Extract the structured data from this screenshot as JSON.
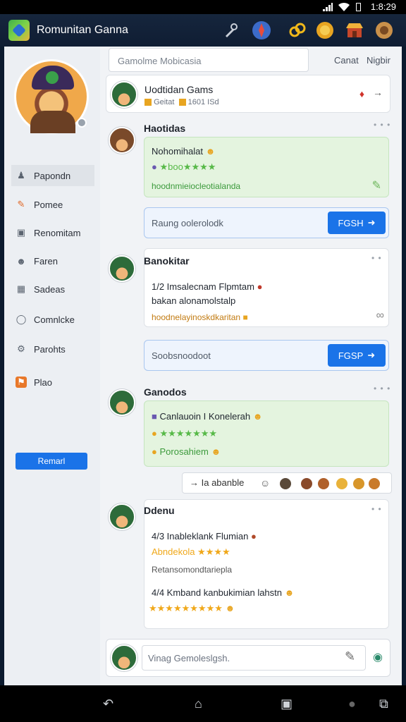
{
  "status_bar": {
    "time": "1:8:29"
  },
  "header": {
    "title": "Romunitan Ganna",
    "icons": [
      "wrench-icon",
      "compass-icon",
      "link-icon",
      "coin-icon",
      "shop-icon",
      "settings-badge-icon"
    ]
  },
  "sidebar": {
    "items": [
      {
        "label": "Papondn",
        "icon": "person-icon"
      },
      {
        "label": "Pomee",
        "icon": "pencil-icon"
      },
      {
        "label": "Renomitam",
        "icon": "window-icon"
      },
      {
        "label": "Faren",
        "icon": "user-icon"
      },
      {
        "label": "Sadeas",
        "icon": "grid-icon"
      },
      {
        "label": "Comnlcke",
        "icon": "chat-icon"
      },
      {
        "label": "Parohts",
        "icon": "gear-icon"
      },
      {
        "label": "Plao",
        "icon": "flag-icon"
      }
    ],
    "button_label": "Remarl"
  },
  "main": {
    "search_placeholder": "Gamolme Mobicasia",
    "links": [
      "Canat",
      "Nigbir"
    ],
    "pinned": {
      "name": "Uodtidan Gams",
      "meta_1": "Geitat",
      "meta_2": "1601",
      "meta_3": "ISd"
    },
    "posts": [
      {
        "name": "Haotidas",
        "dots": "• • •",
        "line_1": "Nohomihalat",
        "line_2": "★boo★★★★",
        "line_3": "hoodnmieiocleotialanda"
      },
      {
        "name": "Banokitar",
        "dots": "• •",
        "line_1": "1/2 Imsalecnam Flpmtam",
        "line_2": "bakan alonamolstalp",
        "line_3": "hoodnelayinoskdkaritan"
      },
      {
        "name": "Ganodos",
        "dots": "• • •",
        "line_1": "Canlauoin I Konelerah",
        "line_2": "★★★★★★★",
        "line_3": "Porosahiem"
      },
      {
        "name": "Ddenu",
        "dots": "• •",
        "line_1": "4/3 Inableklank Flumian",
        "line_2": "Abndekola ★★★★",
        "line_3": "Retansomondtariepla",
        "line_4": "4/4 Kmband kanbukimian lahstn",
        "line_5": "★★★★★★★★★"
      }
    ],
    "inputs": [
      {
        "placeholder": "Raung oolerolodk",
        "button": "FGSH"
      },
      {
        "placeholder": "Soobsnoodoot",
        "button": "FGSP"
      }
    ],
    "reaction_label": "Ia abanble",
    "composer_placeholder": "Vinag Gemoleslgsh."
  }
}
